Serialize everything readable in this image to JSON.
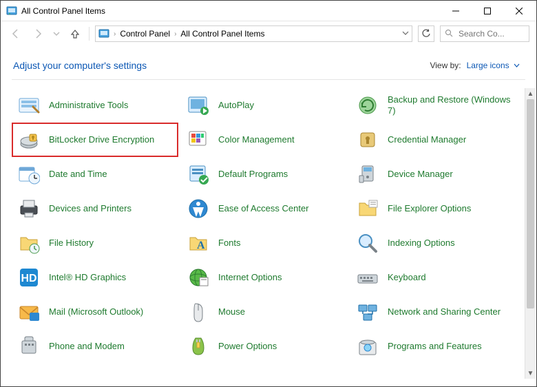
{
  "window": {
    "title": "All Control Panel Items"
  },
  "breadcrumb": {
    "root": "Control Panel",
    "current": "All Control Panel Items"
  },
  "search": {
    "placeholder": "Search Co..."
  },
  "header": {
    "adjust_text": "Adjust your computer's settings",
    "view_by_label": "View by:",
    "view_by_value": "Large icons"
  },
  "items": [
    {
      "id": "administrative-tools",
      "label": "Administrative Tools",
      "icon": "admin-tools-icon"
    },
    {
      "id": "autoplay",
      "label": "AutoPlay",
      "icon": "autoplay-icon"
    },
    {
      "id": "backup-restore",
      "label": "Backup and Restore (Windows 7)",
      "icon": "backup-restore-icon"
    },
    {
      "id": "bitlocker",
      "label": "BitLocker Drive Encryption",
      "icon": "bitlocker-icon",
      "highlight": true
    },
    {
      "id": "color-management",
      "label": "Color Management",
      "icon": "color-management-icon"
    },
    {
      "id": "credential-manager",
      "label": "Credential Manager",
      "icon": "credential-manager-icon"
    },
    {
      "id": "date-time",
      "label": "Date and Time",
      "icon": "date-time-icon"
    },
    {
      "id": "default-programs",
      "label": "Default Programs",
      "icon": "default-programs-icon"
    },
    {
      "id": "device-manager",
      "label": "Device Manager",
      "icon": "device-manager-icon"
    },
    {
      "id": "devices-printers",
      "label": "Devices and Printers",
      "icon": "devices-printers-icon"
    },
    {
      "id": "ease-of-access",
      "label": "Ease of Access Center",
      "icon": "ease-of-access-icon"
    },
    {
      "id": "file-explorer-options",
      "label": "File Explorer Options",
      "icon": "file-explorer-options-icon"
    },
    {
      "id": "file-history",
      "label": "File History",
      "icon": "file-history-icon"
    },
    {
      "id": "fonts",
      "label": "Fonts",
      "icon": "fonts-icon"
    },
    {
      "id": "indexing-options",
      "label": "Indexing Options",
      "icon": "indexing-options-icon"
    },
    {
      "id": "intel-hd-graphics",
      "label": "Intel® HD Graphics",
      "icon": "intel-graphics-icon"
    },
    {
      "id": "internet-options",
      "label": "Internet Options",
      "icon": "internet-options-icon"
    },
    {
      "id": "keyboard",
      "label": "Keyboard",
      "icon": "keyboard-icon"
    },
    {
      "id": "mail",
      "label": "Mail (Microsoft Outlook)",
      "icon": "mail-icon"
    },
    {
      "id": "mouse",
      "label": "Mouse",
      "icon": "mouse-icon"
    },
    {
      "id": "network-sharing",
      "label": "Network and Sharing Center",
      "icon": "network-sharing-icon"
    },
    {
      "id": "phone-modem",
      "label": "Phone and Modem",
      "icon": "phone-modem-icon"
    },
    {
      "id": "power-options",
      "label": "Power Options",
      "icon": "power-options-icon"
    },
    {
      "id": "programs-features",
      "label": "Programs and Features",
      "icon": "programs-features-icon"
    }
  ]
}
